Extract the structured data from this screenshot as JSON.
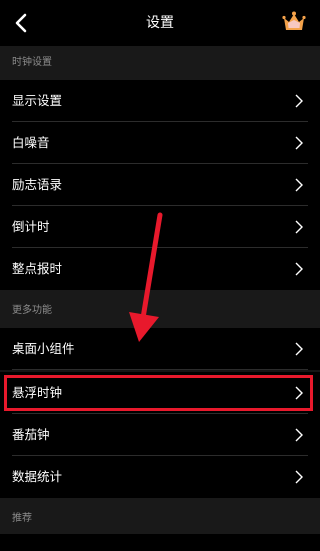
{
  "header": {
    "title": "设置",
    "back_icon": "chevron-left-icon",
    "crown_icon": "crown-icon"
  },
  "sections": [
    {
      "label": "时钟设置",
      "items": [
        {
          "label": "显示设置"
        },
        {
          "label": "白噪音"
        },
        {
          "label": "励志语录"
        },
        {
          "label": "倒计时"
        },
        {
          "label": "整点报时"
        }
      ]
    },
    {
      "label": "更多功能",
      "items": [
        {
          "label": "桌面小组件"
        },
        {
          "label": "悬浮时钟"
        },
        {
          "label": "番茄钟"
        },
        {
          "label": "数据统计"
        }
      ]
    },
    {
      "label": "推荐",
      "items": []
    }
  ],
  "annotation": {
    "highlighted_item": "悬浮时钟",
    "color": "#e8192c"
  },
  "colors": {
    "background": "#000000",
    "section_background": "#191919",
    "section_text": "#8c8c8c",
    "text": "#ffffff",
    "crown_orange": "#f4a24a",
    "crown_pink": "#f7c8c0"
  }
}
